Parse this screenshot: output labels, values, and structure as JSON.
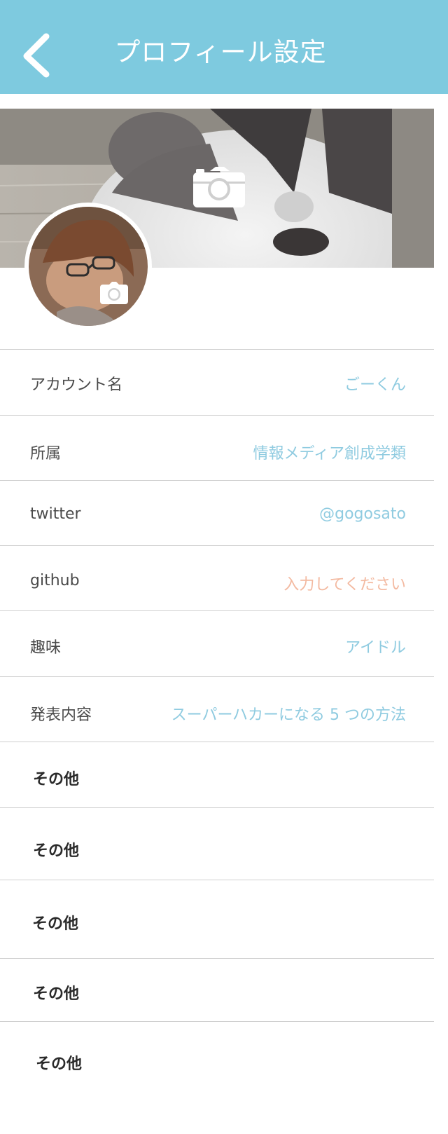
{
  "header": {
    "title": "プロフィール設定",
    "back_icon": "chevron-left-icon",
    "background_color": "#7ecadf"
  },
  "cover": {
    "camera_icon": "camera-icon"
  },
  "avatar": {
    "camera_icon": "camera-icon"
  },
  "fields": [
    {
      "label": "アカウント名",
      "value": "ごーくん",
      "is_placeholder": false
    },
    {
      "label": "所属",
      "value": "情報メディア創成学類",
      "is_placeholder": false
    },
    {
      "label": "twitter",
      "value": "@gogosato",
      "is_placeholder": false
    },
    {
      "label": "github",
      "value": "入力してください",
      "is_placeholder": true
    },
    {
      "label": "趣味",
      "value": "アイドル",
      "is_placeholder": false
    },
    {
      "label": "発表内容",
      "value": "スーパーハカーになる 5 つの方法",
      "is_placeholder": false
    }
  ],
  "others": [
    {
      "label": "その他"
    },
    {
      "label": "その他"
    },
    {
      "label": "その他"
    },
    {
      "label": "その他"
    },
    {
      "label": "その他"
    }
  ],
  "colors": {
    "value_text": "#8fcbe0",
    "placeholder_text": "#f3b9a0",
    "label_text": "#4a4a4a",
    "divider": "#cfcfcf"
  }
}
